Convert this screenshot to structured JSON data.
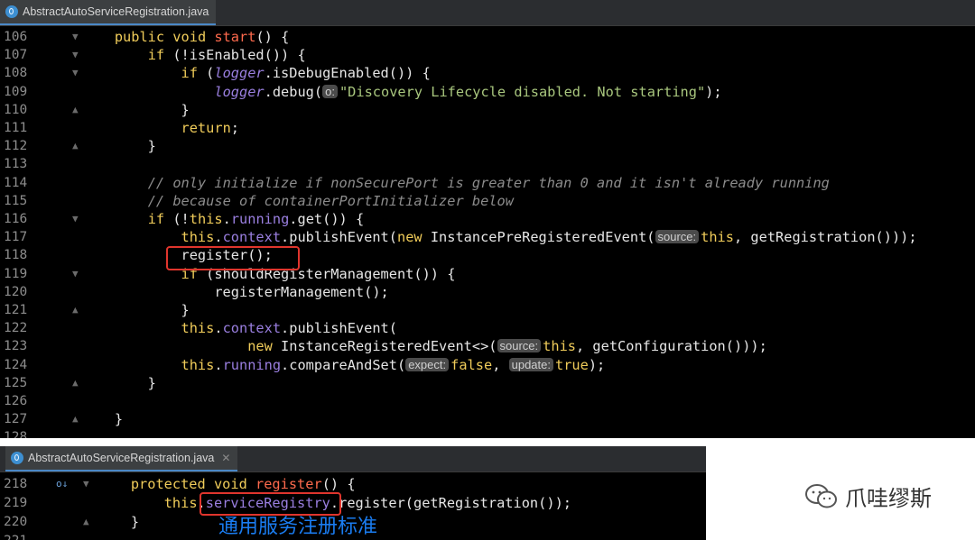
{
  "panel1": {
    "tab_title": "AbstractAutoServiceRegistration.java",
    "lines": [
      {
        "n": "106",
        "html": "    <span class='kw'>public void</span> <span class='fn'>start</span>() {"
      },
      {
        "n": "107",
        "html": "        <span class='kw'>if</span> (!isEnabled()) {"
      },
      {
        "n": "108",
        "html": "            <span class='kw'>if</span> (<span class='it'>logger</span>.isDebugEnabled()) {"
      },
      {
        "n": "109",
        "html": "                <span class='it'>logger</span>.debug(<span class='hint'>o:</span><span class='str'>\"Discovery Lifecycle disabled. Not starting\"</span>);"
      },
      {
        "n": "110",
        "html": "            }"
      },
      {
        "n": "111",
        "html": "            <span class='kw'>return</span>;"
      },
      {
        "n": "112",
        "html": "        }"
      },
      {
        "n": "113",
        "html": ""
      },
      {
        "n": "114",
        "html": "        <span class='cmt'>// only initialize if nonSecurePort is greater than 0 and it isn't already running</span>"
      },
      {
        "n": "115",
        "html": "        <span class='cmt'>// because of containerPortInitializer below</span>"
      },
      {
        "n": "116",
        "html": "        <span class='kw'>if</span> (!<span class='kw'>this</span>.<span class='fld'>running</span>.get()) {"
      },
      {
        "n": "117",
        "html": "            <span class='kw'>this</span>.<span class='fld'>context</span>.publishEvent(<span class='kw'>new</span> InstancePreRegisteredEvent(<span class='hint'>source:</span><span class='kw'>this</span>, getRegistration()));"
      },
      {
        "n": "118",
        "html": "            register();"
      },
      {
        "n": "119",
        "html": "            <span class='kw'>if</span> (shouldRegisterManagement()) {"
      },
      {
        "n": "120",
        "html": "                registerManagement();"
      },
      {
        "n": "121",
        "html": "            }"
      },
      {
        "n": "122",
        "html": "            <span class='kw'>this</span>.<span class='fld'>context</span>.publishEvent("
      },
      {
        "n": "123",
        "html": "                    <span class='kw'>new</span> InstanceRegisteredEvent&lt;&gt;(<span class='hint'>source:</span><span class='kw'>this</span>, getConfiguration()));"
      },
      {
        "n": "124",
        "html": "            <span class='kw'>this</span>.<span class='fld'>running</span>.compareAndSet(<span class='hint'>expect:</span><span class='kw'>false</span>, <span class='hint'>update:</span><span class='kw'>true</span>);"
      },
      {
        "n": "125",
        "html": "        }"
      },
      {
        "n": "126",
        "html": ""
      },
      {
        "n": "127",
        "html": "    }"
      },
      {
        "n": "128",
        "html": ""
      }
    ]
  },
  "panel2": {
    "tab_title": "AbstractAutoServiceRegistration.java",
    "lines": [
      {
        "n": "218",
        "html": "    <span class='kw'>protected void</span> <span class='fn'>register</span>() {"
      },
      {
        "n": "219",
        "html": "        <span class='kw'>this</span>.<span class='fld'>serviceRegistry</span>.register(getRegistration());"
      },
      {
        "n": "220",
        "html": "    }"
      },
      {
        "n": "221",
        "html": ""
      }
    ]
  },
  "annotation": "通用服务注册标准",
  "watermark": "爪哇缪斯",
  "colors": {
    "highlight_box": "#e0352d",
    "annotation": "#1a7cf0",
    "keyword": "#f0cc5a",
    "method_decl": "#ff6a4d"
  }
}
